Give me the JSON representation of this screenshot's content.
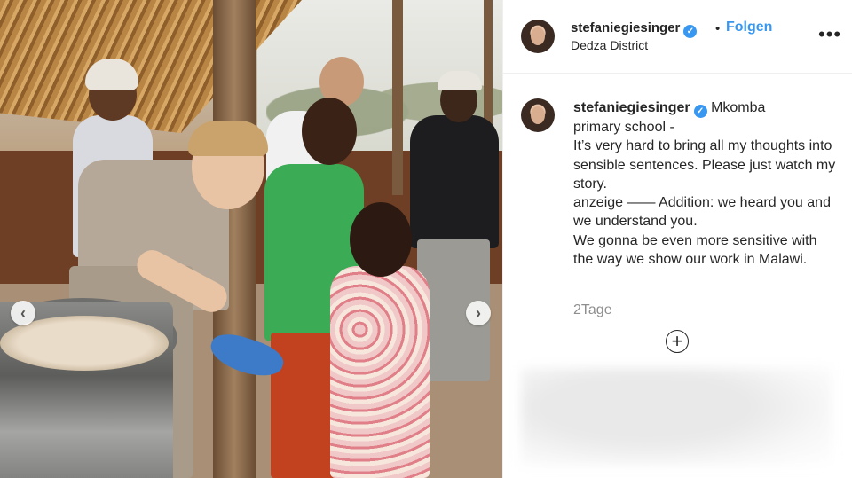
{
  "header": {
    "username": "stefaniegiesinger",
    "verified_icon": "verified-badge-icon",
    "follow_label": "Folgen",
    "follow_separator": "•",
    "location": "Dedza District",
    "more_icon": "more-options-icon"
  },
  "caption": {
    "username": "stefaniegiesinger",
    "text": "Mkomba\nprimary school -\nIt’s very hard to bring all my thoughts into sensible sentences. Please just watch my story.\nanzeige —— Addition: we heard you and we understand you.\nWe gonna be even more sensitive with the way we show our work in Malawi."
  },
  "timestamp": "2Tage",
  "carousel": {
    "prev_icon": "chevron-left-icon",
    "next_icon": "chevron-right-icon",
    "prev_glyph": "‹",
    "next_glyph": "›"
  },
  "comment_add_icon": "plus-circle-icon",
  "colors": {
    "accent": "#3897f0",
    "text": "#262626",
    "muted": "#8e8e8e"
  }
}
